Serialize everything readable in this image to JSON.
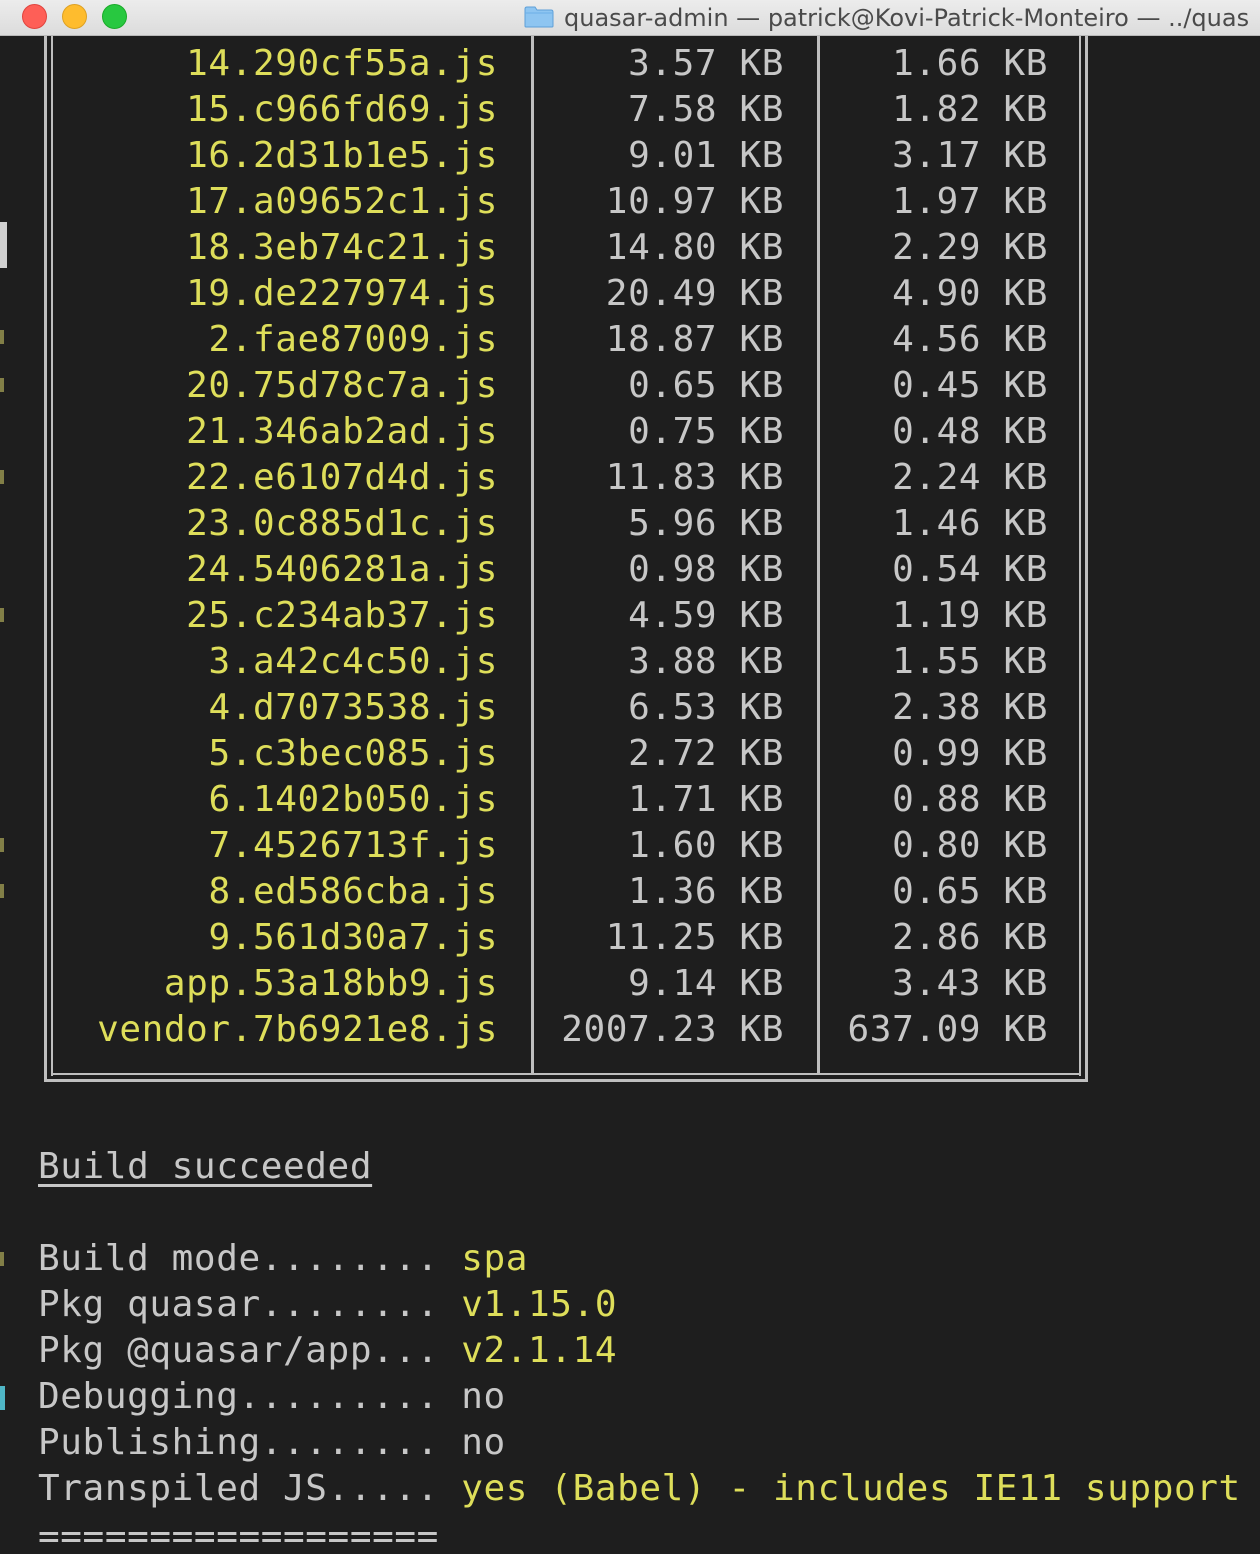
{
  "window": {
    "title": "quasar-admin — patrick@Kovi-Patrick-Monteiro — ../quas"
  },
  "files": [
    {
      "name": "14.290cf55a.js",
      "size": "3.57 KB",
      "gzipped": "1.66 KB"
    },
    {
      "name": "15.c966fd69.js",
      "size": "7.58 KB",
      "gzipped": "1.82 KB"
    },
    {
      "name": "16.2d31b1e5.js",
      "size": "9.01 KB",
      "gzipped": "3.17 KB"
    },
    {
      "name": "17.a09652c1.js",
      "size": "10.97 KB",
      "gzipped": "1.97 KB"
    },
    {
      "name": "18.3eb74c21.js",
      "size": "14.80 KB",
      "gzipped": "2.29 KB"
    },
    {
      "name": "19.de227974.js",
      "size": "20.49 KB",
      "gzipped": "4.90 KB"
    },
    {
      "name": "2.fae87009.js",
      "size": "18.87 KB",
      "gzipped": "4.56 KB"
    },
    {
      "name": "20.75d78c7a.js",
      "size": "0.65 KB",
      "gzipped": "0.45 KB"
    },
    {
      "name": "21.346ab2ad.js",
      "size": "0.75 KB",
      "gzipped": "0.48 KB"
    },
    {
      "name": "22.e6107d4d.js",
      "size": "11.83 KB",
      "gzipped": "2.24 KB"
    },
    {
      "name": "23.0c885d1c.js",
      "size": "5.96 KB",
      "gzipped": "1.46 KB"
    },
    {
      "name": "24.5406281a.js",
      "size": "0.98 KB",
      "gzipped": "0.54 KB"
    },
    {
      "name": "25.c234ab37.js",
      "size": "4.59 KB",
      "gzipped": "1.19 KB"
    },
    {
      "name": "3.a42c4c50.js",
      "size": "3.88 KB",
      "gzipped": "1.55 KB"
    },
    {
      "name": "4.d7073538.js",
      "size": "6.53 KB",
      "gzipped": "2.38 KB"
    },
    {
      "name": "5.c3bec085.js",
      "size": "2.72 KB",
      "gzipped": "0.99 KB"
    },
    {
      "name": "6.1402b050.js",
      "size": "1.71 KB",
      "gzipped": "0.88 KB"
    },
    {
      "name": "7.4526713f.js",
      "size": "1.60 KB",
      "gzipped": "0.80 KB"
    },
    {
      "name": "8.ed586cba.js",
      "size": "1.36 KB",
      "gzipped": "0.65 KB"
    },
    {
      "name": "9.561d30a7.js",
      "size": "11.25 KB",
      "gzipped": "2.86 KB"
    },
    {
      "name": "app.53a18bb9.js",
      "size": "9.14 KB",
      "gzipped": "3.43 KB"
    },
    {
      "name": "vendor.7b6921e8.js",
      "size": "2007.23 KB",
      "gzipped": "637.09 KB"
    }
  ],
  "status": "Build succeeded",
  "info": [
    {
      "label": "Build mode........ ",
      "value": "spa",
      "highlight": true
    },
    {
      "label": "Pkg quasar........ ",
      "value": "v1.15.0",
      "highlight": true
    },
    {
      "label": "Pkg @quasar/app... ",
      "value": "v2.1.14",
      "highlight": true
    },
    {
      "label": "Debugging......... ",
      "value": "no",
      "highlight": false
    },
    {
      "label": "Publishing........ ",
      "value": "no",
      "highlight": false
    },
    {
      "label": "Transpiled JS..... ",
      "value": "yes (Babel) - includes IE11 support",
      "highlight": true
    }
  ],
  "rule": "=================="
}
